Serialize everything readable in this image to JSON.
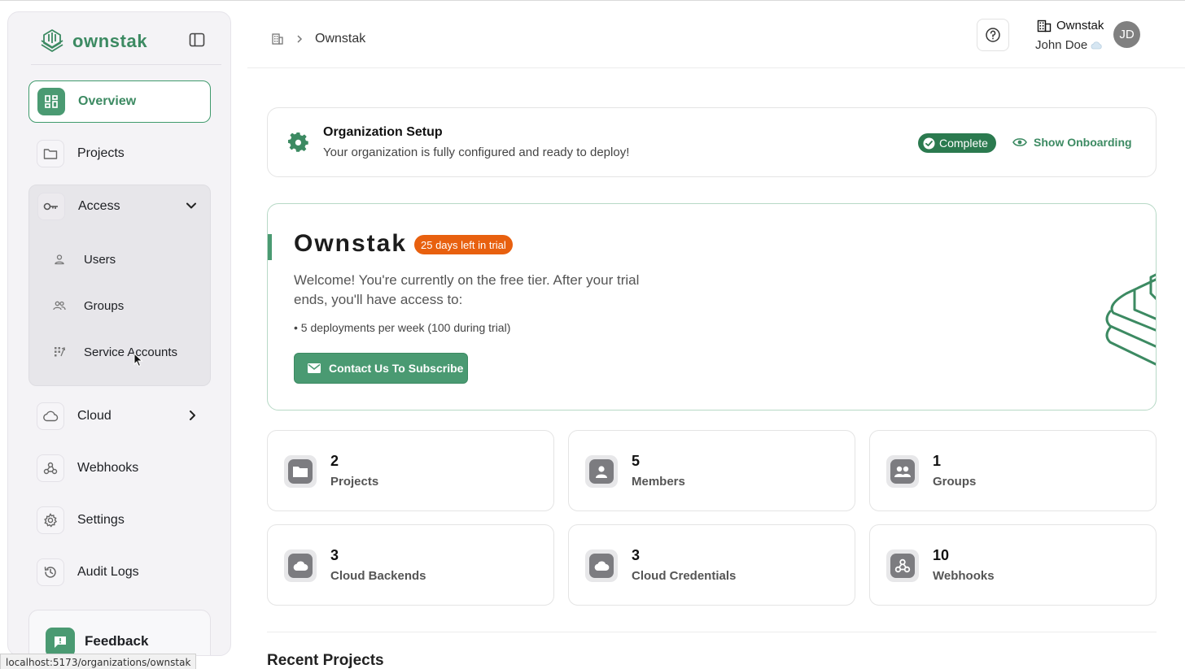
{
  "app": {
    "name": "ownstak"
  },
  "sidebar": {
    "items": [
      {
        "label": "Overview",
        "icon": "dashboard-icon"
      },
      {
        "label": "Projects",
        "icon": "folder-icon"
      },
      {
        "label": "Access",
        "icon": "key-icon"
      },
      {
        "label": "Cloud",
        "icon": "cloud-icon"
      },
      {
        "label": "Webhooks",
        "icon": "webhook-icon"
      },
      {
        "label": "Settings",
        "icon": "gear-icon"
      },
      {
        "label": "Audit Logs",
        "icon": "history-icon"
      }
    ],
    "access_sub": [
      {
        "label": "Users",
        "icon": "person-icon"
      },
      {
        "label": "Groups",
        "icon": "group-icon"
      },
      {
        "label": "Service Accounts",
        "icon": "service-icon"
      }
    ],
    "feedback_label": "Feedback"
  },
  "status_bar_url": "localhost:5173/organizations/ownstak",
  "header": {
    "breadcrumb": "Ownstak",
    "org_name": "Ownstak",
    "user_name": "John Doe",
    "avatar_initials": "JD"
  },
  "setup": {
    "title": "Organization Setup",
    "description": "Your organization is fully configured and ready to deploy!",
    "status": "Complete",
    "action": "Show Onboarding"
  },
  "hero": {
    "title": "Ownstak",
    "trial_badge": "25 days left in trial",
    "description": "Welcome! You're currently on the free tier. After your trial ends, you'll have access to:",
    "bullet": "• 5 deployments per week (100 during trial)",
    "cta": "Contact Us To Subscribe"
  },
  "stats": [
    {
      "value": "2",
      "label": "Projects",
      "icon": "folder-icon"
    },
    {
      "value": "5",
      "label": "Members",
      "icon": "person-icon"
    },
    {
      "value": "1",
      "label": "Groups",
      "icon": "group-icon"
    },
    {
      "value": "3",
      "label": "Cloud Backends",
      "icon": "cloud-icon"
    },
    {
      "value": "3",
      "label": "Cloud Credentials",
      "icon": "cloud-icon"
    },
    {
      "value": "10",
      "label": "Webhooks",
      "icon": "webhook-icon"
    }
  ],
  "recent_projects_title": "Recent Projects",
  "colors": {
    "brand": "#3c8a62",
    "badge_complete": "#2b7a4f",
    "badge_trial": "#e8600f"
  }
}
